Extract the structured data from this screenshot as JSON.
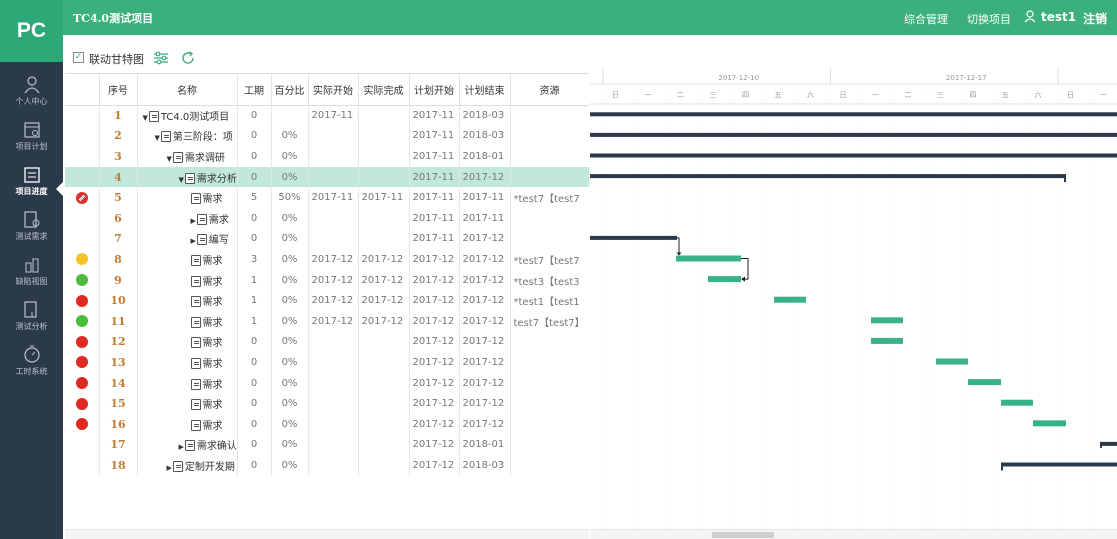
{
  "app": {
    "logo": "PC"
  },
  "header": {
    "project_title": "TC4.0测试项目",
    "nav_manage": "综合管理",
    "nav_switch": "切换项目",
    "user": "test1",
    "logout": "注销"
  },
  "sidebar": {
    "items": [
      {
        "label": "个人中心",
        "icon": "person-icon"
      },
      {
        "label": "项目计划",
        "icon": "calendar-icon"
      },
      {
        "label": "项目进度",
        "icon": "progress-icon",
        "active": true
      },
      {
        "label": "测试需求",
        "icon": "requirement-icon"
      },
      {
        "label": "缺陷视图",
        "icon": "defect-icon"
      },
      {
        "label": "测试分析",
        "icon": "analysis-icon"
      },
      {
        "label": "工时系统",
        "icon": "clock-icon"
      }
    ]
  },
  "toolbar": {
    "gantt_link_label": "联动甘特图",
    "gantt_link_checked": true
  },
  "table": {
    "columns": [
      "序号",
      "名称",
      "工期",
      "百分比",
      "实际开始",
      "实际完成",
      "计划开始",
      "计划结束",
      "资源"
    ],
    "rows": [
      {
        "status": "",
        "seq": "1",
        "indent": 0,
        "toggle": "▼",
        "type": "list",
        "name": "TC4.0测试项目",
        "dur": "0",
        "pct": "",
        "as": "2017-11",
        "af": "",
        "ps": "2017-11",
        "pf": "2018-03",
        "res": ""
      },
      {
        "status": "",
        "seq": "2",
        "indent": 1,
        "toggle": "▼",
        "type": "doc",
        "name": "第三阶段：项",
        "dur": "0",
        "pct": "0%",
        "as": "",
        "af": "",
        "ps": "2017-11",
        "pf": "2018-03",
        "res": ""
      },
      {
        "status": "",
        "seq": "3",
        "indent": 2,
        "toggle": "▼",
        "type": "doc",
        "name": "需求调研",
        "dur": "0",
        "pct": "0%",
        "as": "",
        "af": "",
        "ps": "2017-11",
        "pf": "2018-01",
        "res": ""
      },
      {
        "status": "",
        "seq": "4",
        "indent": 3,
        "toggle": "▼",
        "type": "doc",
        "name": "需求分析",
        "dur": "0",
        "pct": "0%",
        "as": "",
        "af": "",
        "ps": "2017-11",
        "pf": "2017-12",
        "res": "",
        "selected": true
      },
      {
        "status": "overdue",
        "seq": "5",
        "indent": 4,
        "toggle": "",
        "type": "doc",
        "name": "需求",
        "dur": "5",
        "pct": "50%",
        "as": "2017-11",
        "af": "2017-11",
        "ps": "2017-11",
        "pf": "2017-11",
        "res": "*test7【test7"
      },
      {
        "status": "",
        "seq": "6",
        "indent": 4,
        "toggle": "▶",
        "type": "doc",
        "name": "需求",
        "dur": "0",
        "pct": "0%",
        "as": "",
        "af": "",
        "ps": "2017-11",
        "pf": "2017-11",
        "res": ""
      },
      {
        "status": "",
        "seq": "7",
        "indent": 4,
        "toggle": "▶",
        "type": "doc",
        "name": "编写",
        "dur": "0",
        "pct": "0%",
        "as": "",
        "af": "",
        "ps": "2017-11",
        "pf": "2017-12",
        "res": ""
      },
      {
        "status": "yellow",
        "seq": "8",
        "indent": 4,
        "toggle": "",
        "type": "doc",
        "name": "需求",
        "dur": "3",
        "pct": "0%",
        "as": "2017-12",
        "af": "2017-12",
        "ps": "2017-12",
        "pf": "2017-12",
        "res": "*test7【test7"
      },
      {
        "status": "green",
        "seq": "9",
        "indent": 4,
        "toggle": "",
        "type": "doc",
        "name": "需求",
        "dur": "1",
        "pct": "0%",
        "as": "2017-12",
        "af": "2017-12",
        "ps": "2017-12",
        "pf": "2017-12",
        "res": "*test3【test3"
      },
      {
        "status": "red",
        "seq": "10",
        "indent": 4,
        "toggle": "",
        "type": "doc",
        "name": "需求",
        "dur": "1",
        "pct": "0%",
        "as": "2017-12",
        "af": "2017-12",
        "ps": "2017-12",
        "pf": "2017-12",
        "res": "*test1【test1"
      },
      {
        "status": "green",
        "seq": "11",
        "indent": 4,
        "toggle": "",
        "type": "doc",
        "name": "需求",
        "dur": "1",
        "pct": "0%",
        "as": "2017-12",
        "af": "2017-12",
        "ps": "2017-12",
        "pf": "2017-12",
        "res": "test7【test7】"
      },
      {
        "status": "red",
        "seq": "12",
        "indent": 4,
        "toggle": "",
        "type": "doc",
        "name": "需求",
        "dur": "0",
        "pct": "0%",
        "as": "",
        "af": "",
        "ps": "2017-12",
        "pf": "2017-12",
        "res": ""
      },
      {
        "status": "red",
        "seq": "13",
        "indent": 4,
        "toggle": "",
        "type": "doc",
        "name": "需求",
        "dur": "0",
        "pct": "0%",
        "as": "",
        "af": "",
        "ps": "2017-12",
        "pf": "2017-12",
        "res": ""
      },
      {
        "status": "red",
        "seq": "14",
        "indent": 4,
        "toggle": "",
        "type": "doc",
        "name": "需求",
        "dur": "0",
        "pct": "0%",
        "as": "",
        "af": "",
        "ps": "2017-12",
        "pf": "2017-12",
        "res": ""
      },
      {
        "status": "red",
        "seq": "15",
        "indent": 4,
        "toggle": "",
        "type": "doc",
        "name": "需求",
        "dur": "0",
        "pct": "0%",
        "as": "",
        "af": "",
        "ps": "2017-12",
        "pf": "2017-12",
        "res": ""
      },
      {
        "status": "red",
        "seq": "16",
        "indent": 4,
        "toggle": "",
        "type": "doc",
        "name": "需求",
        "dur": "0",
        "pct": "0%",
        "as": "",
        "af": "",
        "ps": "2017-12",
        "pf": "2017-12",
        "res": ""
      },
      {
        "status": "",
        "seq": "17",
        "indent": 3,
        "toggle": "▶",
        "type": "doc",
        "name": "需求确认",
        "dur": "0",
        "pct": "0%",
        "as": "",
        "af": "",
        "ps": "2017-12",
        "pf": "2018-01",
        "res": ""
      },
      {
        "status": "",
        "seq": "18",
        "indent": 2,
        "toggle": "▶",
        "type": "doc",
        "name": "定制开发期",
        "dur": "0",
        "pct": "0%",
        "as": "",
        "af": "",
        "ps": "2017-12",
        "pf": "2018-03",
        "res": ""
      }
    ]
  },
  "gantt": {
    "weeks": [
      "2017-12-10",
      "2017-12-17"
    ],
    "day_labels": [
      "日",
      "一",
      "二",
      "三",
      "四",
      "五",
      "六",
      "日",
      "一",
      "二",
      "三",
      "四",
      "五",
      "六",
      "日",
      "一"
    ],
    "colors": {
      "summary": "#2b3a4a",
      "task": "#38b28b",
      "overdue": "#d9322e",
      "yellow": "#f6c427",
      "green": "#4cbb3b",
      "red": "#e02a21",
      "selected": "#c2e8dc"
    }
  }
}
